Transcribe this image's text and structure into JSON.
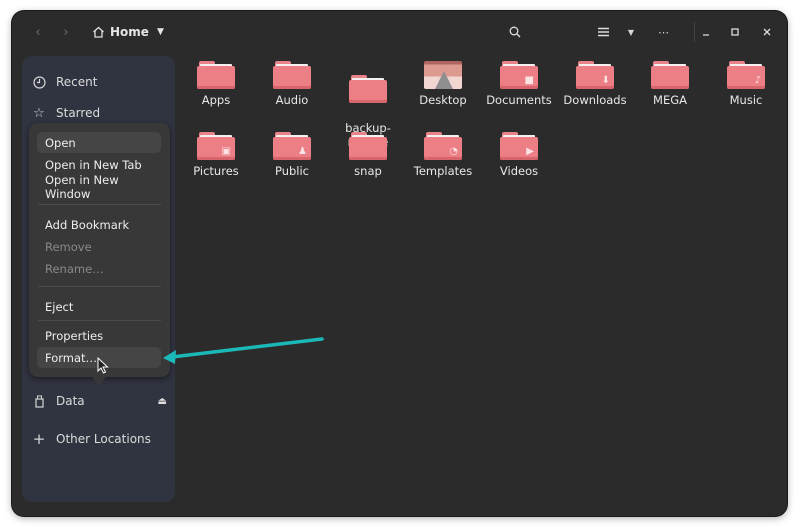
{
  "header": {
    "location": "Home",
    "icons": {
      "back": "chevron-left-icon",
      "forward": "chevron-right-icon",
      "home": "home-icon",
      "path_dropdown": "triangle-down-icon",
      "search": "search-icon",
      "view_list": "list-view-icon",
      "view_dropdown": "triangle-down-icon",
      "more": "ellipsis-icon",
      "minimize": "minimize-icon",
      "maximize": "maximize-icon",
      "close": "close-icon"
    }
  },
  "sidebar": {
    "items": [
      {
        "label": "Recent",
        "icon": "clock-icon"
      },
      {
        "label": "Starred",
        "icon": "star-icon"
      },
      {
        "label": "Data",
        "icon": "usb-drive-icon",
        "action_icon": "eject-icon"
      },
      {
        "label": "Other Locations",
        "icon": "plus-icon"
      }
    ]
  },
  "context_menu": {
    "items": [
      {
        "label": "Open",
        "enabled": true,
        "highlighted": true
      },
      {
        "label": "Open in New Tab",
        "enabled": true
      },
      {
        "label": "Open in New Window",
        "enabled": true
      },
      {
        "label": "Add Bookmark",
        "enabled": true
      },
      {
        "label": "Remove",
        "enabled": false
      },
      {
        "label": "Rename…",
        "enabled": false
      },
      {
        "label": "Eject",
        "enabled": true
      },
      {
        "label": "Properties",
        "enabled": true
      },
      {
        "label": "Format…",
        "enabled": true,
        "hovered": true
      }
    ]
  },
  "files": [
    {
      "name": "Apps",
      "emblem": ""
    },
    {
      "name": "Audio",
      "emblem": ""
    },
    {
      "name": "backup-\nrestore",
      "emblem": ""
    },
    {
      "name": "Desktop",
      "emblem": "desktop"
    },
    {
      "name": "Documents",
      "emblem": "document"
    },
    {
      "name": "Downloads",
      "emblem": "download"
    },
    {
      "name": "MEGA",
      "emblem": ""
    },
    {
      "name": "Music",
      "emblem": "music"
    },
    {
      "name": "Pictures",
      "emblem": "picture"
    },
    {
      "name": "Public",
      "emblem": "people"
    },
    {
      "name": "snap",
      "emblem": ""
    },
    {
      "name": "Templates",
      "emblem": "template"
    },
    {
      "name": "Videos",
      "emblem": "video"
    }
  ],
  "annotation": {
    "arrow_color": "#1bb8b8",
    "points_to": "Format…"
  },
  "colors": {
    "folder": "#ec7f85",
    "window_bg": "#2b2b2b",
    "sidebar_bg": "#303340"
  }
}
